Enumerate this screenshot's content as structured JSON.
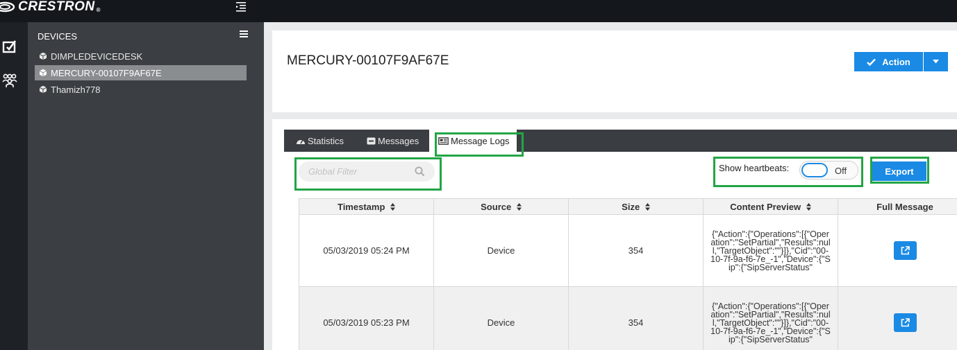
{
  "app": {
    "brand": "CRESTRON",
    "brand_mark": "®"
  },
  "sidebar": {
    "title": "DEVICES",
    "items": [
      {
        "label": "DIMPLEDEVICEDESK",
        "selected": false
      },
      {
        "label": "MERCURY-00107F9AF67E",
        "selected": true
      },
      {
        "label": "Thamizh778",
        "selected": false
      }
    ]
  },
  "header": {
    "device_title": "MERCURY-00107F9AF67E",
    "action_label": "Action"
  },
  "tabs": [
    {
      "label": "Statistics",
      "icon": "dashboard-icon"
    },
    {
      "label": "Messages",
      "icon": "envelope-icon"
    },
    {
      "label": "Message Logs",
      "icon": "newspaper-icon",
      "active": true
    }
  ],
  "toolbar": {
    "filter_placeholder": "Global Filter",
    "heartbeat_label": "Show heartbeats:",
    "heartbeat_state": "Off",
    "export_label": "Export"
  },
  "table": {
    "columns": [
      "Timestamp",
      "Source",
      "Size",
      "Content Preview",
      "Full Message"
    ],
    "rows": [
      {
        "timestamp": "05/03/2019 05:24 PM",
        "source": "Device",
        "size": "354",
        "preview": "{\"Action\":{\"Operations\":[{\"Operation\":\"SetPartial\",\"Results\":null,\"TargetObject\":\"\"}]},\"Cid\":\"00-10-7f-9a-f6-7e_-1\",\"Device\":{\"Sip\":{\"SipServerStatus\""
      },
      {
        "timestamp": "05/03/2019 05:23 PM",
        "source": "Device",
        "size": "354",
        "preview": "{\"Action\":{\"Operations\":[{\"Operation\":\"SetPartial\",\"Results\":null,\"TargetObject\":\"\"}]},\"Cid\":\"00-10-7f-9a-f6-7e_-1\",\"Device\":{\"Sip\":{\"SipServerStatus\""
      }
    ]
  },
  "colors": {
    "accent": "#1a8ae4",
    "highlight": "#22a545",
    "topbar": "#14181c",
    "sidebar": "#3b3f43"
  }
}
